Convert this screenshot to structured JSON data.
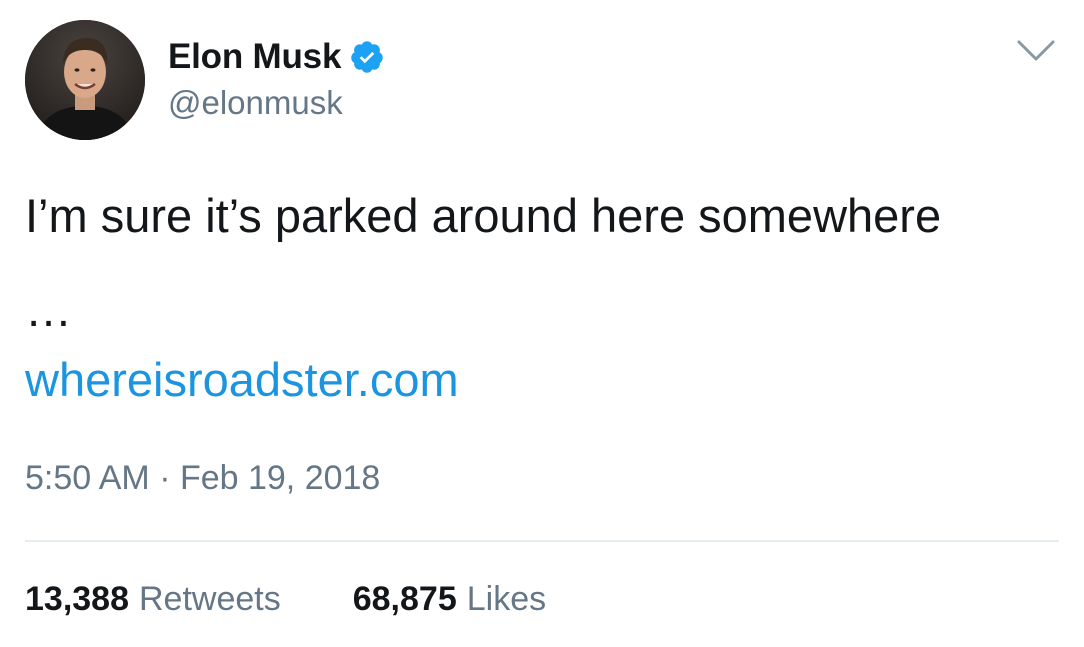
{
  "author": {
    "display_name": "Elon Musk",
    "handle": "@elonmusk",
    "verified": true
  },
  "tweet": {
    "text": "I’m sure it’s parked around here somewhere",
    "ellipsis": "…",
    "link": "whereisroadster.com",
    "timestamp": "5:50 AM · Feb 19, 2018"
  },
  "stats": {
    "retweets_count": "13,388",
    "retweets_label": "Retweets",
    "likes_count": "68,875",
    "likes_label": "Likes"
  },
  "colors": {
    "link": "#1b95e0",
    "verified_badge": "#1da1f2",
    "secondary_text": "#657786",
    "primary_text": "#14171a"
  },
  "icons": {
    "verified": "verified-badge-icon",
    "menu": "chevron-down-icon"
  }
}
